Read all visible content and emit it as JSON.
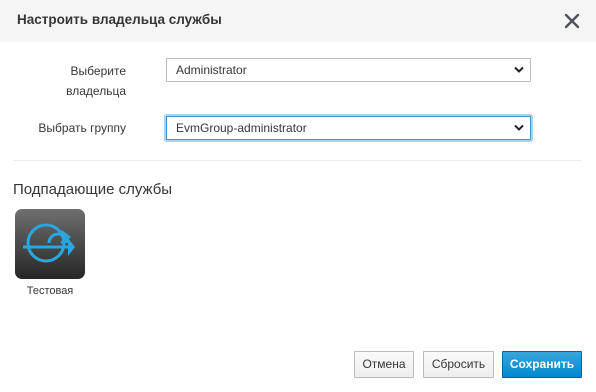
{
  "dialog": {
    "title": "Настроить владельца службы",
    "close_icon": "close-icon"
  },
  "form": {
    "owner": {
      "label_line1": "Выберите",
      "label_line2": "владельца",
      "value": "Administrator"
    },
    "group": {
      "label": "Выбрать группу",
      "value": "EvmGroup-administrator"
    }
  },
  "services": {
    "heading": "Подпадающие службы",
    "items": [
      {
        "name": "Тестовая",
        "icon": "service-arrow-icon"
      }
    ]
  },
  "footer": {
    "cancel_label": "Отмена",
    "reset_label": "Сбросить",
    "save_label": "Сохранить"
  },
  "colors": {
    "primary": "#0088ce",
    "focus": "#3a93cf",
    "icon_accent": "#29a7e0"
  }
}
